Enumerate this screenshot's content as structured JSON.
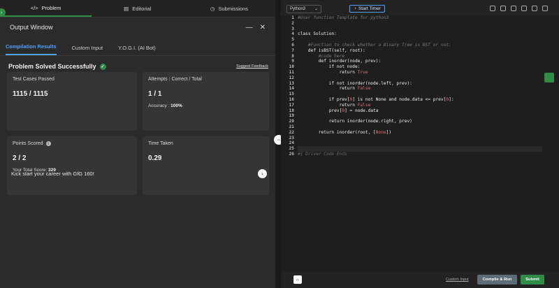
{
  "nav": {
    "tabs": [
      {
        "label": "Problem",
        "icon": "code-icon",
        "active": true
      },
      {
        "label": "Editorial",
        "icon": "book-icon",
        "active": false
      },
      {
        "label": "Submissions",
        "icon": "clock-icon",
        "active": false
      }
    ]
  },
  "output": {
    "title": "Output Window",
    "subtabs": [
      "Compilation Results",
      "Custom Input",
      "Y.O.G.I. (AI Bot)"
    ],
    "status": "Problem Solved Successfully",
    "feedback": "Suggest Feedback",
    "cards": {
      "tests_label": "Test Cases Passed",
      "tests_value": "1115 / 1115",
      "attempts_label": "Attempts : Correct / Total",
      "attempts_value": "1 / 1",
      "accuracy_label": "Accuracy :",
      "accuracy_value": "100%",
      "points_label": "Points Scored",
      "points_value": "2 / 2",
      "total_label": "Your Total Score:",
      "total_value": "329",
      "time_label": "Time Taken",
      "time_value": "0.29"
    },
    "career": "Kick start your career with GfG 160!"
  },
  "editor": {
    "language": "Python3",
    "timer": "Start Timer",
    "lines": [
      {
        "n": "1",
        "segments": [
          {
            "t": "#User function Template for python3",
            "c": "cm"
          }
        ]
      },
      {
        "n": "2",
        "segments": []
      },
      {
        "n": "3",
        "segments": []
      },
      {
        "n": "4",
        "segments": [
          {
            "t": "class Solution:",
            "c": "kw"
          }
        ]
      },
      {
        "n": "5",
        "segments": []
      },
      {
        "n": "6",
        "segments": [
          {
            "t": "    #Function to check whether a Binary Tree is BST or not.",
            "c": "cm"
          }
        ]
      },
      {
        "n": "7",
        "segments": [
          {
            "t": "    def isBST(self, root):",
            "c": "tx"
          }
        ]
      },
      {
        "n": "8",
        "segments": [
          {
            "t": "        #code here",
            "c": "cm"
          }
        ]
      },
      {
        "n": "9",
        "segments": [
          {
            "t": "        def inorder(node, prev):",
            "c": "tx"
          }
        ]
      },
      {
        "n": "10",
        "segments": [
          {
            "t": "            if not node:",
            "c": "tx"
          }
        ]
      },
      {
        "n": "11",
        "segments": [
          {
            "t": "                return ",
            "c": "tx"
          },
          {
            "t": "True",
            "c": "str"
          }
        ]
      },
      {
        "n": "12",
        "segments": []
      },
      {
        "n": "13",
        "segments": [
          {
            "t": "            if not inorder(node.left, prev):",
            "c": "tx"
          }
        ]
      },
      {
        "n": "14",
        "segments": [
          {
            "t": "                return ",
            "c": "tx"
          },
          {
            "t": "False",
            "c": "str"
          }
        ]
      },
      {
        "n": "15",
        "segments": []
      },
      {
        "n": "16",
        "segments": [
          {
            "t": "            if prev[",
            "c": "tx"
          },
          {
            "t": "0",
            "c": "str"
          },
          {
            "t": "] is not None and node.data <= prev[",
            "c": "tx"
          },
          {
            "t": "0",
            "c": "str"
          },
          {
            "t": "]:",
            "c": "tx"
          }
        ]
      },
      {
        "n": "17",
        "segments": [
          {
            "t": "                return ",
            "c": "tx"
          },
          {
            "t": "False",
            "c": "str"
          }
        ]
      },
      {
        "n": "18",
        "segments": [
          {
            "t": "            prev[",
            "c": "tx"
          },
          {
            "t": "0",
            "c": "str"
          },
          {
            "t": "] = node.data",
            "c": "tx"
          }
        ]
      },
      {
        "n": "19",
        "segments": []
      },
      {
        "n": "20",
        "segments": [
          {
            "t": "            return inorder(node.right, prev)",
            "c": "tx"
          }
        ]
      },
      {
        "n": "21",
        "segments": []
      },
      {
        "n": "22",
        "segments": [
          {
            "t": "        return inorder(root, [",
            "c": "tx"
          },
          {
            "t": "None",
            "c": "str"
          },
          {
            "t": "])",
            "c": "tx"
          }
        ]
      },
      {
        "n": "23",
        "segments": []
      },
      {
        "n": "24",
        "segments": []
      },
      {
        "n": "25",
        "segments": []
      },
      {
        "n": "26",
        "segments": [
          {
            "t": "#{ Driver Code Ends",
            "c": "drv"
          }
        ]
      }
    ]
  },
  "bottom": {
    "custom_input": "Custom Input",
    "compile": "Compile & Run",
    "submit": "Submit"
  }
}
